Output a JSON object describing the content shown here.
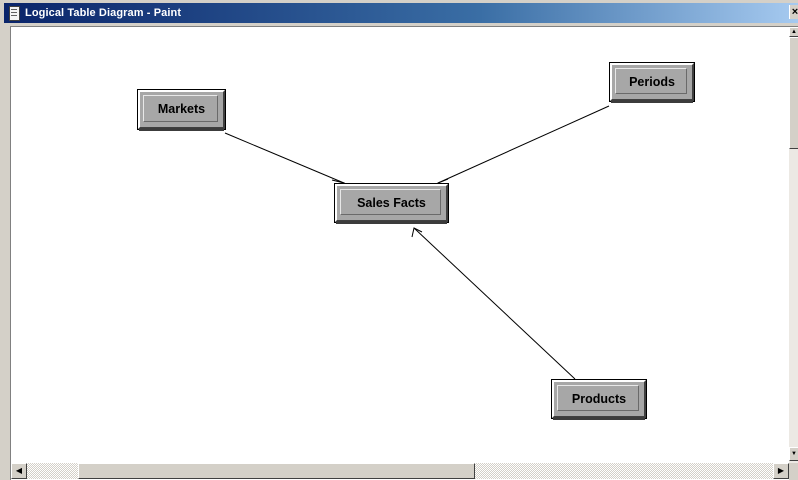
{
  "window": {
    "title": "Logical Table Diagram - Paint",
    "close_glyph": "×"
  },
  "diagram": {
    "nodes": [
      {
        "id": "markets",
        "label": "Markets"
      },
      {
        "id": "periods",
        "label": "Periods"
      },
      {
        "id": "sales_facts",
        "label": "Sales Facts"
      },
      {
        "id": "products",
        "label": "Products"
      }
    ],
    "links": [
      {
        "from": "Markets",
        "to": "Sales Facts"
      },
      {
        "from": "Periods",
        "to": "Sales Facts"
      },
      {
        "from": "Products",
        "to": "Sales Facts"
      }
    ]
  },
  "scrollbars": {
    "up_glyph": "▲",
    "down_glyph": "▼",
    "left_glyph": "◀",
    "right_glyph": "▶"
  },
  "icons": {
    "window_icon": "document-icon"
  }
}
